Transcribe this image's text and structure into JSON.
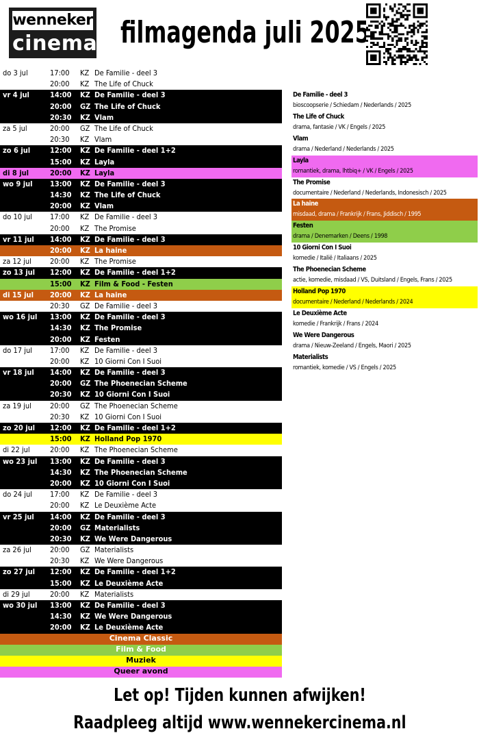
{
  "logo": {
    "top": "wenneker",
    "bottom": "cinema"
  },
  "header": {
    "title": "filmagenda juli 2025"
  },
  "colors": {
    "orange": "#c55a11",
    "green": "#8fce4a",
    "yellow": "#ffff00",
    "pink": "#f06af0",
    "dark": "#000000"
  },
  "schedule": [
    {
      "date": "do 3 jul",
      "dark": false,
      "rows": [
        {
          "time": "17:00",
          "hall": "KZ",
          "title": "De Familie - deel 3"
        },
        {
          "time": "20:00",
          "hall": "KZ",
          "title": "The Life of Chuck"
        }
      ]
    },
    {
      "date": "vr 4 jul",
      "dark": true,
      "rows": [
        {
          "time": "14:00",
          "hall": "KZ",
          "title": "De Familie - deel 3"
        },
        {
          "time": "20:00",
          "hall": "GZ",
          "title": "The Life of Chuck"
        },
        {
          "time": "20:30",
          "hall": "KZ",
          "title": "Vlam"
        }
      ]
    },
    {
      "date": "za 5 jul",
      "dark": false,
      "rows": [
        {
          "time": "20:00",
          "hall": "GZ",
          "title": "The Life of Chuck"
        },
        {
          "time": "20:30",
          "hall": "KZ",
          "title": "Vlam"
        }
      ]
    },
    {
      "date": "zo 6 jul",
      "dark": true,
      "rows": [
        {
          "time": "12:00",
          "hall": "KZ",
          "title": "De Familie - deel 1+2"
        },
        {
          "time": "15:00",
          "hall": "KZ",
          "title": "Layla"
        }
      ]
    },
    {
      "date": "di 8 jul",
      "dark": false,
      "rows": [
        {
          "time": "20:00",
          "hall": "KZ",
          "title": "Layla",
          "hl": "pink"
        }
      ]
    },
    {
      "date": "wo 9 jul",
      "dark": true,
      "rows": [
        {
          "time": "13:00",
          "hall": "KZ",
          "title": "De Familie - deel 3"
        },
        {
          "time": "14:30",
          "hall": "KZ",
          "title": "The Life of Chuck"
        },
        {
          "time": "20:00",
          "hall": "KZ",
          "title": "Vlam"
        }
      ]
    },
    {
      "date": "do 10 jul",
      "dark": false,
      "rows": [
        {
          "time": "17:00",
          "hall": "KZ",
          "title": "De Familie - deel 3"
        },
        {
          "time": "20:00",
          "hall": "KZ",
          "title": "The Promise"
        }
      ]
    },
    {
      "date": "vr 11 jul",
      "dark": true,
      "rows": [
        {
          "time": "14:00",
          "hall": "KZ",
          "title": "De Familie - deel 3"
        },
        {
          "time": "20:00",
          "hall": "KZ",
          "title": "La haine",
          "hl": "orange"
        }
      ]
    },
    {
      "date": "za 12 jul",
      "dark": false,
      "rows": [
        {
          "time": "20:00",
          "hall": "KZ",
          "title": "The Promise"
        }
      ]
    },
    {
      "date": "zo 13 jul",
      "dark": true,
      "rows": [
        {
          "time": "12:00",
          "hall": "KZ",
          "title": "De Familie - deel 1+2"
        },
        {
          "time": "15:00",
          "hall": "KZ",
          "title": "Film & Food - Festen",
          "hl": "green"
        }
      ]
    },
    {
      "date": "di 15 jul",
      "dark": false,
      "rows": [
        {
          "time": "20:00",
          "hall": "KZ",
          "title": "La haine",
          "hl": "orange"
        },
        {
          "time": "20:30",
          "hall": "GZ",
          "title": "De Familie - deel 3"
        }
      ]
    },
    {
      "date": "wo 16 jul",
      "dark": true,
      "rows": [
        {
          "time": "13:00",
          "hall": "KZ",
          "title": "De Familie - deel 3"
        },
        {
          "time": "14:30",
          "hall": "KZ",
          "title": "The Promise"
        },
        {
          "time": "20:00",
          "hall": "KZ",
          "title": "Festen"
        }
      ]
    },
    {
      "date": "do 17 jul",
      "dark": false,
      "rows": [
        {
          "time": "17:00",
          "hall": "KZ",
          "title": "De Familie - deel 3"
        },
        {
          "time": "20:00",
          "hall": "KZ",
          "title": "10 Giorni Con I Suoi"
        }
      ]
    },
    {
      "date": "vr 18 jul",
      "dark": true,
      "rows": [
        {
          "time": "14:00",
          "hall": "KZ",
          "title": "De Familie - deel 3"
        },
        {
          "time": "20:00",
          "hall": "GZ",
          "title": "The Phoenecian Scheme"
        },
        {
          "time": "20:30",
          "hall": "KZ",
          "title": "10 Giorni Con I Suoi"
        }
      ]
    },
    {
      "date": "za 19 jul",
      "dark": false,
      "rows": [
        {
          "time": "20:00",
          "hall": "GZ",
          "title": "The Phoenecian Scheme"
        },
        {
          "time": "20:30",
          "hall": "KZ",
          "title": "10 Giorni Con I Suoi"
        }
      ]
    },
    {
      "date": "zo 20 jul",
      "dark": true,
      "rows": [
        {
          "time": "12:00",
          "hall": "KZ",
          "title": "De Familie - deel 1+2"
        },
        {
          "time": "15:00",
          "hall": "KZ",
          "title": "Holland Pop 1970",
          "hl": "yellow"
        }
      ]
    },
    {
      "date": "di 22 jul",
      "dark": false,
      "rows": [
        {
          "time": "20:00",
          "hall": "KZ",
          "title": "The Phoenecian Scheme"
        }
      ]
    },
    {
      "date": "wo 23 jul",
      "dark": true,
      "rows": [
        {
          "time": "13:00",
          "hall": "KZ",
          "title": "De Familie - deel 3"
        },
        {
          "time": "14:30",
          "hall": "KZ",
          "title": "The Phoenecian Scheme"
        },
        {
          "time": "20:00",
          "hall": "KZ",
          "title": "10 Giorni Con I Suoi"
        }
      ]
    },
    {
      "date": "do 24 jul",
      "dark": false,
      "rows": [
        {
          "time": "17:00",
          "hall": "KZ",
          "title": "De Familie - deel 3"
        },
        {
          "time": "20:00",
          "hall": "KZ",
          "title": "Le Deuxième Acte"
        }
      ]
    },
    {
      "date": "vr 25 jul",
      "dark": true,
      "rows": [
        {
          "time": "14:00",
          "hall": "KZ",
          "title": "De Familie - deel 3"
        },
        {
          "time": "20:00",
          "hall": "GZ",
          "title": "Materialists"
        },
        {
          "time": "20:30",
          "hall": "KZ",
          "title": "We Were Dangerous"
        }
      ]
    },
    {
      "date": "za 26 jul",
      "dark": false,
      "rows": [
        {
          "time": "20:00",
          "hall": "GZ",
          "title": "Materialists"
        },
        {
          "time": "20:30",
          "hall": "KZ",
          "title": "We Were Dangerous"
        }
      ]
    },
    {
      "date": "zo 27 jul",
      "dark": true,
      "rows": [
        {
          "time": "12:00",
          "hall": "KZ",
          "title": "De Familie - deel 1+2"
        },
        {
          "time": "15:00",
          "hall": "KZ",
          "title": "Le Deuxième Acte"
        }
      ]
    },
    {
      "date": "di 29 jul",
      "dark": false,
      "rows": [
        {
          "time": "20:00",
          "hall": "KZ",
          "title": "Materialists"
        }
      ]
    },
    {
      "date": "wo 30 jul",
      "dark": true,
      "rows": [
        {
          "time": "13:00",
          "hall": "KZ",
          "title": "De Familie - deel 3"
        },
        {
          "time": "14:30",
          "hall": "KZ",
          "title": "We Were Dangerous"
        },
        {
          "time": "20:00",
          "hall": "KZ",
          "title": "Le Deuxième Acte"
        }
      ]
    }
  ],
  "legend": [
    {
      "label": "Cinema Classic",
      "color": "orange"
    },
    {
      "label": "Film & Food",
      "color": "green"
    },
    {
      "label": "Muziek",
      "color": "yellow"
    },
    {
      "label": "Queer avond",
      "color": "pink"
    }
  ],
  "films": [
    {
      "title": "De Familie - deel 3",
      "meta": "bioscoopserie / Schiedam / Nederlands / 2025"
    },
    {
      "title": "The Life of Chuck",
      "meta": "drama, fantasie / VK / Engels / 2025"
    },
    {
      "title": "Vlam",
      "meta": "drama / Nederland / Nederlands / 2025"
    },
    {
      "title": "Layla",
      "meta": "romantiek, drama, lhtbiq+ / VK / Engels / 2025",
      "hl": "pink"
    },
    {
      "title": "The Promise",
      "meta": "documentaire / Nederland / Nederlands, Indonesisch / 2025"
    },
    {
      "title": "La haine",
      "meta": "misdaad, drama / Frankrijk / Frans, Jiddisch / 1995",
      "hl": "orange"
    },
    {
      "title": "Festen",
      "meta": "drama / Denemarken / Deens / 1998",
      "hl": "green"
    },
    {
      "title": "10 Giorni Con I Suoi",
      "meta": "komedie / Italië / Italiaans / 2025"
    },
    {
      "title": "The Phoenecian Scheme",
      "meta": "actie, komedie, misdaad / VS, Duitsland / Engels, Frans / 2025"
    },
    {
      "title": "Holland Pop 1970",
      "meta": "documentaire / Nederland / Nederlands / 2024",
      "hl": "yellow"
    },
    {
      "title": "Le Deuxième Acte",
      "meta": "komedie / Frankrijk / Frans / 2024"
    },
    {
      "title": "We Were Dangerous",
      "meta": "drama / Nieuw-Zeeland / Engels, Maori / 2025"
    },
    {
      "title": "Materialists",
      "meta": "romantiek, komedie / VS / Engels / 2025"
    }
  ],
  "footer": {
    "line1": "Let op! Tijden kunnen afwijken!",
    "line2": "Raadpleeg altijd www.wennekercinema.nl"
  }
}
